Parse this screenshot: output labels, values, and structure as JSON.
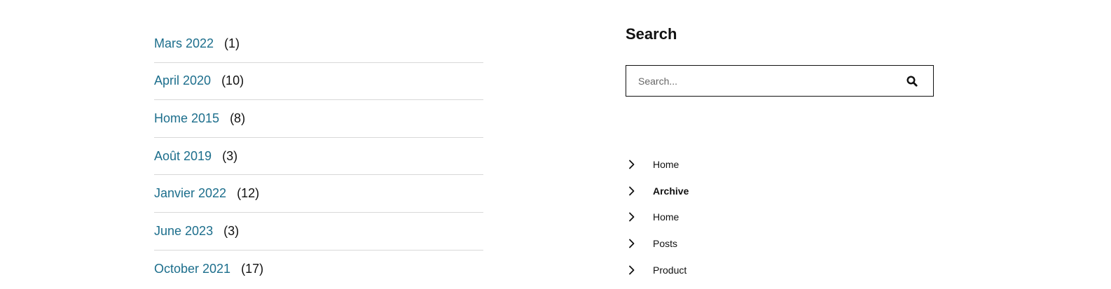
{
  "archives": [
    {
      "label": "Mars 2022",
      "count": "(1)"
    },
    {
      "label": "April 2020",
      "count": "(10)"
    },
    {
      "label": "Home 2015",
      "count": "(8)"
    },
    {
      "label": "Août 2019",
      "count": "(3)"
    },
    {
      "label": "Janvier 2022",
      "count": "(12)"
    },
    {
      "label": "June 2023",
      "count": "(3)"
    },
    {
      "label": "October 2021",
      "count": "(17)"
    }
  ],
  "search": {
    "title": "Search",
    "placeholder": "Search...",
    "value": "",
    "button_icon": "search-icon"
  },
  "nav": {
    "icon": "chevron-right-icon",
    "items": [
      {
        "label": "Home",
        "active": false
      },
      {
        "label": "Archive",
        "active": true
      },
      {
        "label": "Home",
        "active": false
      },
      {
        "label": "Posts",
        "active": false
      },
      {
        "label": "Product",
        "active": false
      }
    ]
  },
  "colors": {
    "link": "#1c6e8c",
    "text": "#111111",
    "divider": "#d8d8d8"
  }
}
